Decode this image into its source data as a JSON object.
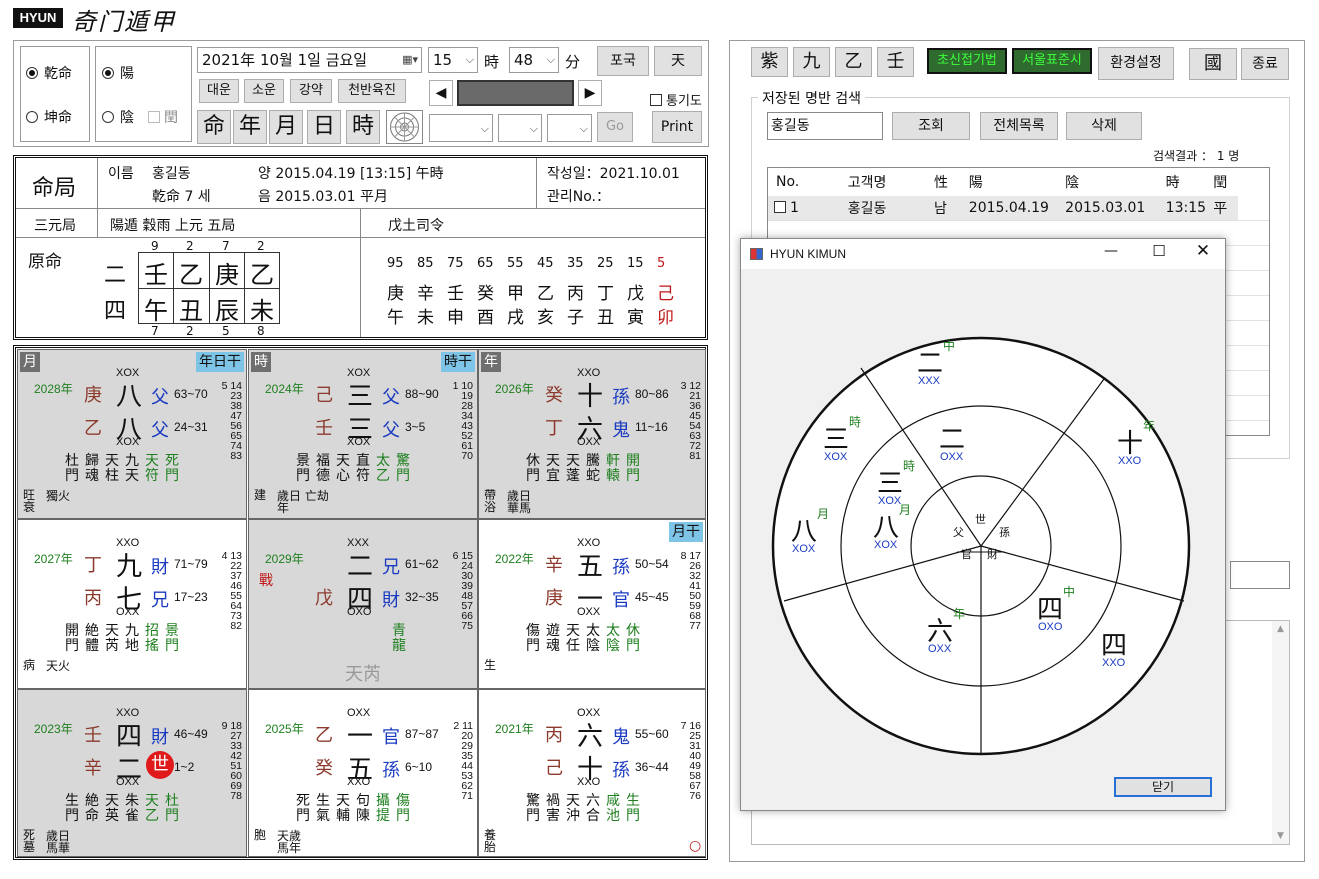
{
  "header": {
    "logo": "HYUN",
    "title": "奇门遁甲"
  },
  "controls": {
    "gender": [
      "乾命",
      "坤命"
    ],
    "yinyang": [
      "陽",
      "陰"
    ],
    "run_label": "閏",
    "date": "2021年 10월  1일 금요일",
    "hour": "15",
    "hour_unit": "時",
    "minute": "48",
    "minute_unit": "分",
    "btn_pogook": "포국",
    "btn_heaven": "天",
    "tabs": [
      "대운",
      "소운",
      "강약",
      "천반육진"
    ],
    "prev": "◀",
    "next": "▶",
    "cb_pass": "통기도",
    "pillars": [
      "命",
      "年",
      "月",
      "日",
      "時"
    ],
    "go": "Go",
    "print": "Print"
  },
  "info": {
    "title": "命局",
    "name_label": "이름",
    "name": "홍길동",
    "yang": "양 2015.04.19  [13:15]  午時",
    "gender_age": "乾命 7 세",
    "yin": "음 2015.03.01  平月",
    "written": "작성일：2021.10.01",
    "manage": "관리No.：",
    "sanyuan": "三元局",
    "ju": "陽遁 穀雨 上元 五局",
    "siling": "戊土司令"
  },
  "wonmyeong": {
    "label": "原命",
    "top_nums": [
      "9",
      "2",
      "7",
      "2"
    ],
    "bot_nums": [
      "7",
      "2",
      "5",
      "8"
    ],
    "left": [
      "二",
      "四"
    ],
    "stems": [
      "壬",
      "乙",
      "庚",
      "乙"
    ],
    "branches": [
      "午",
      "丑",
      "辰",
      "未"
    ]
  },
  "daeun": {
    "ages": [
      "95",
      "85",
      "75",
      "65",
      "55",
      "45",
      "35",
      "25",
      "15",
      "5"
    ],
    "stems": [
      "庚",
      "辛",
      "壬",
      "癸",
      "甲",
      "乙",
      "丙",
      "丁",
      "戊",
      "己"
    ],
    "branches": [
      "午",
      "未",
      "申",
      "酉",
      "戌",
      "亥",
      "子",
      "丑",
      "寅",
      "卯"
    ]
  },
  "palaces": [
    {
      "lab": "月",
      "badge": "年日干",
      "year": "2028年",
      "s1": "庚",
      "s2": "乙",
      "code1": "XOX",
      "code2": "XOX",
      "n1": "八",
      "n2": "八",
      "r1": "父",
      "r2": "父",
      "a1": "63~70",
      "a2": "24~31",
      "seq": "5 14 23 38 47 56 65 74 83",
      "bottom": [
        "杜門",
        "歸魂",
        "天柱",
        "九天",
        "天符",
        "死門"
      ],
      "foot1": "旺衰",
      "foot2": "獨火"
    },
    {
      "lab": "時",
      "badge": "時干",
      "year": "2024年",
      "s1": "己",
      "s2": "壬",
      "code1": "XOX",
      "code2": "XOX",
      "n1": "三",
      "n2": "三",
      "r1": "父",
      "r2": "父",
      "a1": "88~90",
      "a2": "3~5",
      "seq": "1 10 19 28 34 43 52 61 70",
      "bottom": [
        "景門",
        "福德",
        "天心",
        "直符",
        "太乙",
        "驚門"
      ],
      "foot1": "建",
      "foot2": "歲日 亡劫年"
    },
    {
      "lab": "年",
      "badge": "",
      "year": "2026年",
      "s1": "癸",
      "s2": "丁",
      "code1": "XXO",
      "code2": "OXX",
      "n1": "十",
      "n2": "六",
      "r1": "孫",
      "r2": "鬼",
      "a1": "80~86",
      "a2": "11~16",
      "seq": "3 12 21 36 45 54 63 72 81",
      "bottom": [
        "休門",
        "天宜",
        "天蓬",
        "騰蛇",
        "軒轅",
        "開門"
      ],
      "foot1": "帶浴",
      "foot2": "歲日 華馬"
    },
    {
      "lab": "",
      "badge": "",
      "year": "2027年",
      "s1": "丁",
      "s2": "丙",
      "code1": "XXO",
      "code2": "OXX",
      "n1": "九",
      "n2": "七",
      "r1": "財",
      "r2": "兄",
      "a1": "71~79",
      "a2": "17~23",
      "seq": "4 13 22 37 46 55 64 73 82",
      "bottom": [
        "開門",
        "絶體",
        "天芮",
        "九地",
        "招搖",
        "景門"
      ],
      "foot1": "病",
      "foot2": "天火"
    },
    {
      "lab": "",
      "badge": "",
      "year": "2029年",
      "s1": "",
      "s2": "戊",
      "code1": "XXX",
      "code2": "OXO",
      "n1": "二",
      "n2": "四",
      "r1": "兄",
      "r2": "財",
      "a1": "61~62",
      "a2": "32~35",
      "seq": "6 15 24 30 39 48 57 66 75",
      "bottom": [
        "青龍"
      ],
      "foot1": "",
      "foot2": "天芮",
      "war": "戰"
    },
    {
      "lab": "",
      "badge": "月干",
      "year": "2022年",
      "s1": "辛",
      "s2": "庚",
      "code1": "XXO",
      "code2": "OXX",
      "n1": "五",
      "n2": "一",
      "r1": "孫",
      "r2": "官",
      "a1": "50~54",
      "a2": "45~45",
      "seq": "8 17 26 32 41 50 59 68 77",
      "bottom": [
        "傷門",
        "遊魂",
        "天任",
        "太陰",
        "太陰",
        "休門"
      ],
      "foot1": "生",
      "foot2": ""
    },
    {
      "lab": "",
      "badge": "",
      "year": "2023年",
      "s1": "壬",
      "s2": "辛",
      "code1": "XXO",
      "code2": "OXX",
      "n1": "四",
      "n2": "二",
      "r1": "財",
      "r2": "世",
      "a1": "46~49",
      "a2": "1~2",
      "seq": "9 18 27 33 42 51 60 69 78",
      "bottom": [
        "生門",
        "絶命",
        "天英",
        "朱雀",
        "天乙",
        "杜門"
      ],
      "foot1": "死墓",
      "foot2": "歲日 馬華"
    },
    {
      "lab": "",
      "badge": "",
      "year": "2025年",
      "s1": "乙",
      "s2": "癸",
      "code1": "OXX",
      "code2": "XXO",
      "n1": "一",
      "n2": "五",
      "r1": "官",
      "r2": "孫",
      "a1": "87~87",
      "a2": "6~10",
      "seq": "2 11 20 29 35 44 53 62 71",
      "bottom": [
        "死門",
        "生氣",
        "天輔",
        "句陳",
        "攝提",
        "傷門"
      ],
      "foot1": "胞",
      "foot2": "天歲 馬年"
    },
    {
      "lab": "",
      "badge": "",
      "year": "2021年",
      "s1": "丙",
      "s2": "己",
      "code1": "OXX",
      "code2": "XXO",
      "n1": "六",
      "n2": "十",
      "r1": "鬼",
      "r2": "孫",
      "a1": "55~60",
      "a2": "36~44",
      "seq": "7 16 25 31 40 49 58 67 76",
      "bottom": [
        "驚門",
        "禍害",
        "天沖",
        "六合",
        "咸池",
        "生門"
      ],
      "foot1": "養胎",
      "foot2": "○"
    }
  ],
  "right": {
    "buttons": [
      "紫",
      "九",
      "乙",
      "壬"
    ],
    "green1": "초신접기법",
    "green2": "서울표준시",
    "settings": "환경설정",
    "country": "國",
    "exit": "종료",
    "search_group": "저장된 명반 검색",
    "search_value": "홍길동",
    "btn_query": "조회",
    "btn_all": "전체목록",
    "btn_delete": "삭제",
    "result_label": "검색결과 ：",
    "result_count": "1",
    "result_unit": "명",
    "headers": [
      "No.",
      "고객명",
      "性",
      "陽",
      "陰",
      "時",
      "閏"
    ],
    "row": [
      "1",
      "홍길동",
      "남",
      "2015.04.19",
      "2015.03.01",
      "13:15",
      "平"
    ]
  },
  "dialog": {
    "title": "HYUN KIMUN",
    "close": "닫기",
    "outer": [
      {
        "n": "二",
        "t": "中",
        "c": "XXX"
      },
      {
        "n": "十",
        "t": "年",
        "c": "XXO"
      },
      {
        "n": "四",
        "t": "",
        "c": "XXO"
      },
      {
        "n": "六",
        "t": "年",
        "c": "OXX"
      },
      {
        "n": "八",
        "t": "月",
        "c": "XOX"
      },
      {
        "n": "三",
        "t": "時",
        "c": "XOX"
      }
    ],
    "middle": [
      {
        "n": "二",
        "t": "",
        "c": "OXX"
      },
      {
        "n": "三",
        "t": "時",
        "c": "XOX"
      },
      {
        "n": "八",
        "t": "月",
        "c": "XOX"
      },
      {
        "n": "四",
        "t": "中",
        "c": "OXO"
      }
    ],
    "inner": [
      "世",
      "孫",
      "財",
      "官",
      "父"
    ]
  }
}
